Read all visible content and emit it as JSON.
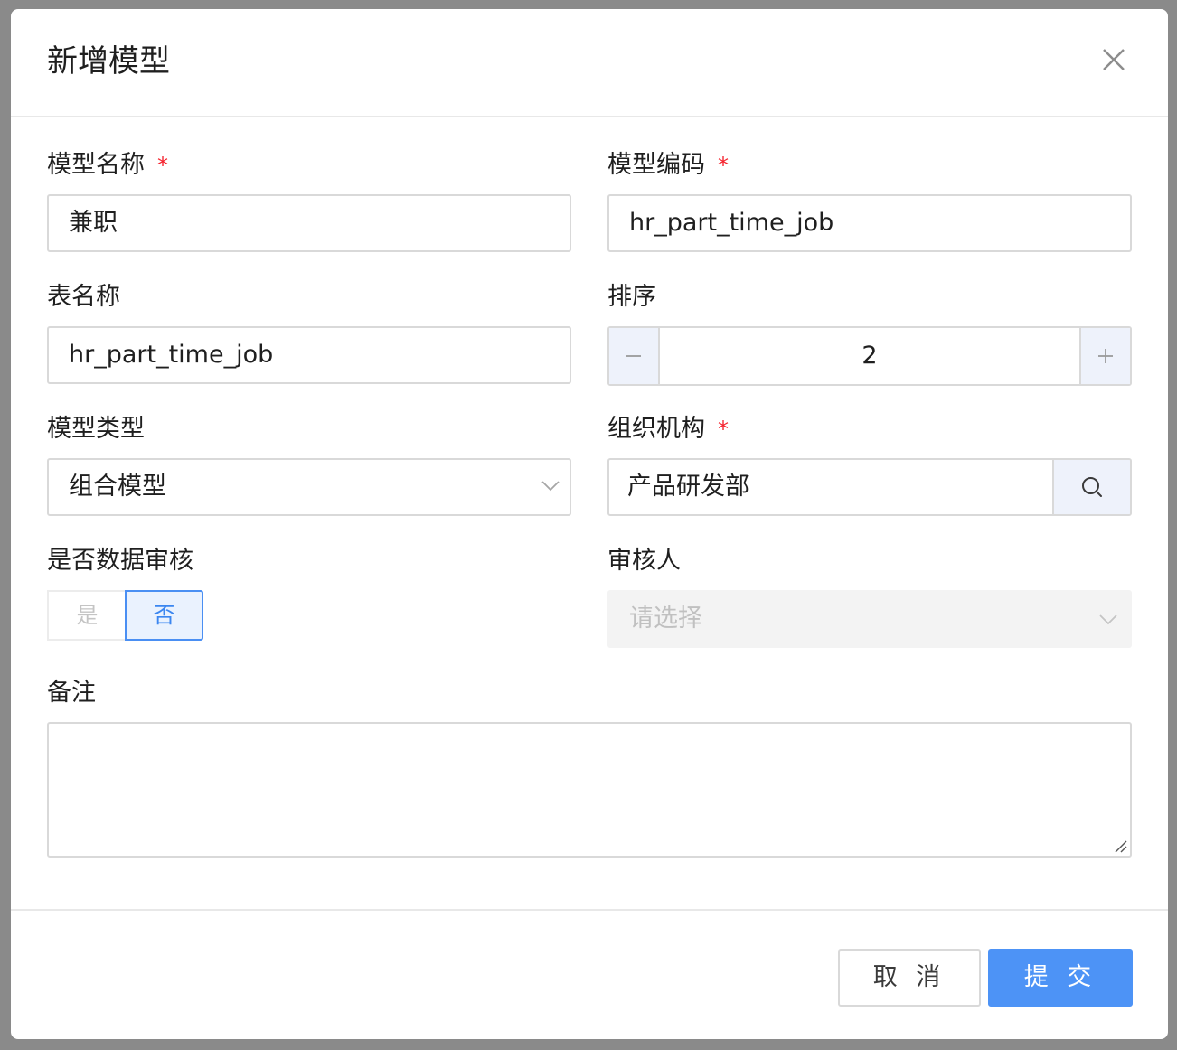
{
  "dialog": {
    "title": "新增模型"
  },
  "form": {
    "model_name": {
      "label": "模型名称",
      "required": "*",
      "value": "兼职"
    },
    "model_code": {
      "label": "模型编码",
      "required": "*",
      "value": "hr_part_time_job"
    },
    "table_name": {
      "label": "表名称",
      "value": "hr_part_time_job"
    },
    "sort": {
      "label": "排序",
      "value": "2"
    },
    "model_type": {
      "label": "模型类型",
      "value": "组合模型"
    },
    "organization": {
      "label": "组织机构",
      "required": "*",
      "value": "产品研发部"
    },
    "data_review": {
      "label": "是否数据审核",
      "option_yes": "是",
      "option_no": "否",
      "selected": "否"
    },
    "reviewer": {
      "label": "审核人",
      "placeholder": "请选择"
    },
    "remark": {
      "label": "备注",
      "value": ""
    }
  },
  "footer": {
    "cancel_label": "取 消",
    "submit_label": "提 交"
  },
  "colors": {
    "primary": "#4d93f6",
    "required": "#f5222d",
    "selected_toggle_border": "#4a8ff3"
  },
  "icons": {
    "close": "close-icon",
    "dropdown": "chevron-down-icon",
    "search": "search-icon",
    "minus": "minus-icon",
    "plus": "plus-icon"
  }
}
